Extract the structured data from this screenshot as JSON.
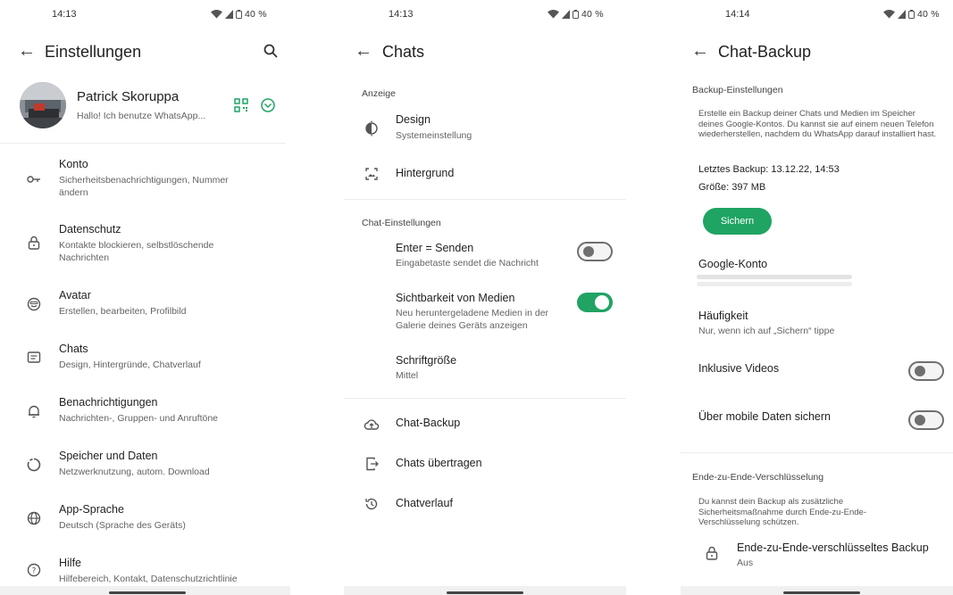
{
  "colors": {
    "accent": "#21a363",
    "toggle_off": "#6f6f6f",
    "divider": "#ececec"
  },
  "settings": {
    "status_time": "14:13",
    "status_right": "40 %",
    "title": "Einstellungen",
    "profile": {
      "name": "Patrick Skoruppa",
      "status": "Hallo! Ich benutze WhatsApp..."
    },
    "items": [
      {
        "icon": "key-icon",
        "title": "Konto",
        "sub": "Sicherheitsbenachrichtigungen, Nummer ändern"
      },
      {
        "icon": "lock-icon",
        "title": "Datenschutz",
        "sub": "Kontakte blockieren, selbstlöschende Nachrichten"
      },
      {
        "icon": "avatar-icon",
        "title": "Avatar",
        "sub": "Erstellen, bearbeiten, Profilbild"
      },
      {
        "icon": "chat-icon",
        "title": "Chats",
        "sub": "Design, Hintergründe, Chatverlauf"
      },
      {
        "icon": "bell-icon",
        "title": "Benachrichtigungen",
        "sub": "Nachrichten-, Gruppen- und Anruftöne"
      },
      {
        "icon": "storage-icon",
        "title": "Speicher und Daten",
        "sub": "Netzwerknutzung, autom. Download"
      },
      {
        "icon": "globe-icon",
        "title": "App-Sprache",
        "sub": "Deutsch (Sprache des Geräts)"
      },
      {
        "icon": "help-icon",
        "title": "Hilfe",
        "sub": "Hilfebereich, Kontakt, Datenschutzrichtlinie"
      }
    ]
  },
  "chats": {
    "status_time": "14:13",
    "status_right": "40 %",
    "title": "Chats",
    "section_display": "Anzeige",
    "design": {
      "title": "Design",
      "sub": "Systemeinstellung"
    },
    "wallpaper": {
      "title": "Hintergrund"
    },
    "section_chat_settings": "Chat-Einstellungen",
    "enter_send": {
      "title": "Enter = Senden",
      "sub": "Eingabetaste sendet die Nachricht",
      "on": false
    },
    "media_visibility": {
      "title": "Sichtbarkeit von Medien",
      "sub": "Neu heruntergeladene Medien in der Galerie deines Geräts anzeigen",
      "on": true
    },
    "font_size": {
      "title": "Schriftgröße",
      "sub": "Mittel"
    },
    "chat_backup": "Chat-Backup",
    "transfer": "Chats übertragen",
    "history": "Chatverlauf"
  },
  "backup": {
    "status_time": "14:14",
    "status_right": "40 %",
    "title": "Chat-Backup",
    "section_settings": "Backup-Einstellungen",
    "description": "Erstelle ein Backup deiner Chats und Medien im Speicher deines Google-Kontos. Du kannst sie auf einem neuen Telefon wiederherstellen, nachdem du WhatsApp darauf installiert hast.",
    "last_backup": "Letztes Backup: 13.12.22, 14:53",
    "size": "Größe: 397 MB",
    "backup_button": "Sichern",
    "google_account": "Google-Konto",
    "frequency_title": "Häufigkeit",
    "frequency_value": "Nur, wenn ich auf „Sichern“ tippe",
    "include_videos": {
      "title": "Inklusive Videos",
      "on": false
    },
    "mobile_data": {
      "title": "Über mobile Daten sichern",
      "on": false
    },
    "section_e2e": "Ende-zu-Ende-Verschlüsselung",
    "e2e_description": "Du kannst dein Backup als zusätzliche Sicherheitsmaßnahme durch Ende-zu-Ende-Verschlüsselung schützen.",
    "e2e_item": {
      "title": "Ende-zu-Ende-verschlüsseltes Backup",
      "sub": "Aus"
    }
  }
}
